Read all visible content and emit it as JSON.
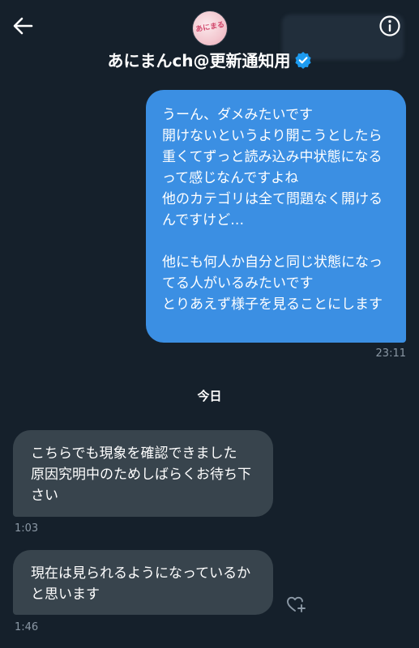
{
  "header": {
    "title": "あにまんch@更新通知用",
    "avatar_text": "あにまる"
  },
  "messages": {
    "outgoing": {
      "text": "うーん、ダメみたいです\n開けないというより開こうとしたら重くてずっと読み込み中状態になるって感じなんですよね\n他のカテゴリは全て問題なく開けるんですけど…\n\n他にも何人か自分と同じ状態になってる人がいるみたいです\nとりあえず様子を見ることにします",
      "time": "23:11"
    },
    "day_separator": "今日",
    "incoming": [
      {
        "text": "こちらでも現象を確認できました\n原因究明中のためしばらくお待ち下さい",
        "time": "1:03"
      },
      {
        "text": "現在は見られるようになっているかと思います",
        "time": "1:46"
      }
    ]
  },
  "colors": {
    "background": "#15202b",
    "outgoing_bubble": "#3b8fe3",
    "incoming_bubble": "#38444d",
    "verified": "#1d9bf0"
  }
}
